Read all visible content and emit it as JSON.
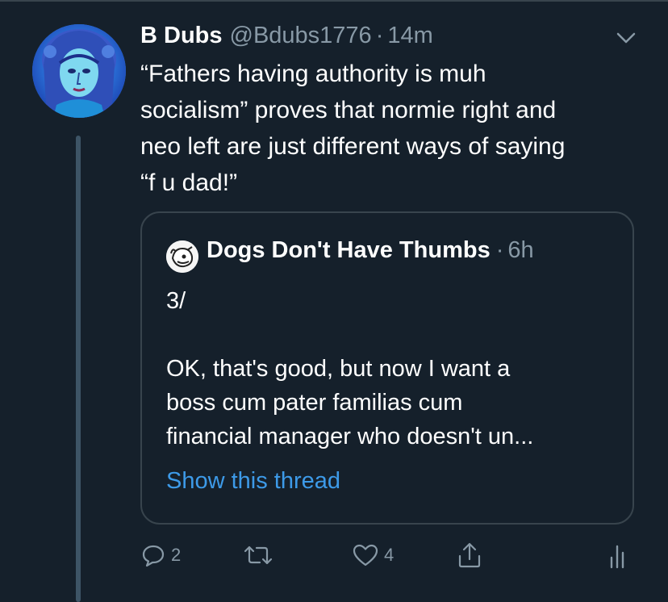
{
  "tweet": {
    "author_name": "B Dubs",
    "author_handle": "@Bdubs1776",
    "separator": "·",
    "timestamp": "14m",
    "text": "“Fathers having authority is muh\nsocialism” proves that normie right and\nneo left are just different ways of saying\n“f u dad!”",
    "menu_icon": "chevron-down-icon"
  },
  "quoted_tweet": {
    "author_name": "Dogs Don't Have Thumbs",
    "separator": "·",
    "timestamp": "6h",
    "text": "3/\n\nOK, that's good, but now I want a\nboss cum pater familias cum\nfinancial manager who doesn't un...",
    "show_thread_label": "Show this thread"
  },
  "actions": {
    "reply": {
      "icon": "reply-icon",
      "count": "2"
    },
    "retweet": {
      "icon": "retweet-icon",
      "count": ""
    },
    "like": {
      "icon": "heart-icon",
      "count": "4"
    },
    "share": {
      "icon": "share-icon"
    },
    "analytics": {
      "icon": "analytics-icon"
    }
  },
  "colors": {
    "background": "#15202b",
    "secondary_text": "#8899a6",
    "link": "#3d9ae8",
    "border": "#38444d"
  }
}
